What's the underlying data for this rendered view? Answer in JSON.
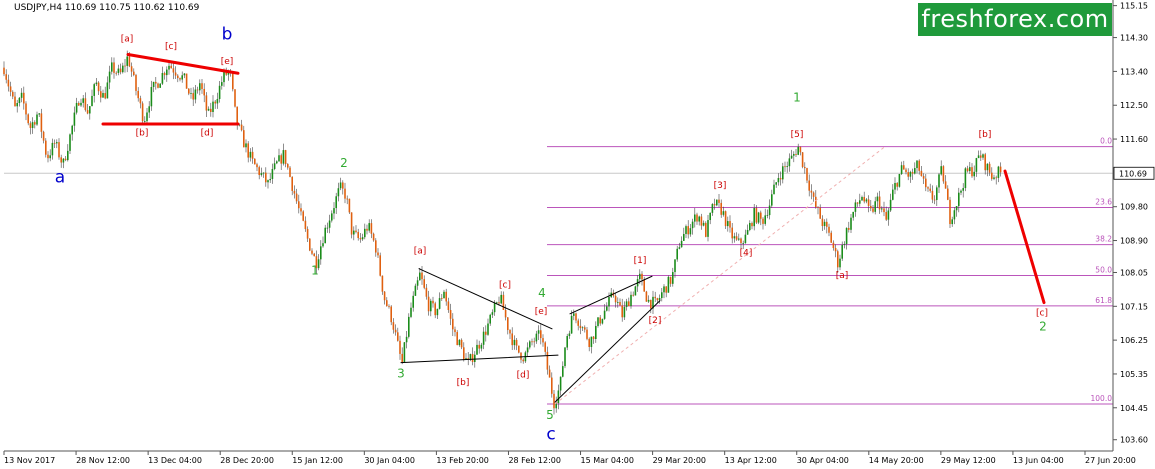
{
  "header": {
    "title": "USDJPY,H4  110.69 110.75 110.62 110.69",
    "brand": "freshforex.com"
  },
  "chart_data": {
    "type": "candlestick",
    "symbol": "USDJPY",
    "timeframe": "H4",
    "ohlc_readout": {
      "open": 110.69,
      "high": 110.75,
      "low": 110.62,
      "close": 110.69
    },
    "current_price": 110.69,
    "current_price_label": "110.69",
    "ylim": [
      103.3,
      115.3
    ],
    "y_ticks": [
      {
        "value": 115.15,
        "label": "115.15"
      },
      {
        "value": 114.3,
        "label": "114.30"
      },
      {
        "value": 113.4,
        "label": "113.40"
      },
      {
        "value": 112.5,
        "label": "112.50"
      },
      {
        "value": 111.6,
        "label": "111.60"
      },
      {
        "value": 109.8,
        "label": "109.80"
      },
      {
        "value": 108.9,
        "label": "108.90"
      },
      {
        "value": 108.05,
        "label": "108.05"
      },
      {
        "value": 107.15,
        "label": "107.15"
      },
      {
        "value": 106.25,
        "label": "106.25"
      },
      {
        "value": 105.35,
        "label": "105.35"
      },
      {
        "value": 104.45,
        "label": "104.45"
      },
      {
        "value": 103.6,
        "label": "103.60"
      }
    ],
    "x_ticks": [
      "13 Nov 2017",
      "28 Nov 12:00",
      "13 Dec 04:00",
      "28 Dec 20:00",
      "15 Jan 12:00",
      "30 Jan 04:00",
      "13 Feb 20:00",
      "28 Feb 12:00",
      "15 Mar 04:00",
      "29 Mar 20:00",
      "13 Apr 12:00",
      "30 Apr 04:00",
      "14 May 20:00",
      "29 May 12:00",
      "13 Jun 04:00",
      "27 Jun 20:00"
    ],
    "fibonacci": [
      {
        "level": "0.0",
        "price": 111.4
      },
      {
        "level": "23.6",
        "price": 109.78
      },
      {
        "level": "38.2",
        "price": 108.79
      },
      {
        "level": "50.0",
        "price": 107.97
      },
      {
        "level": "61.8",
        "price": 107.16
      },
      {
        "level": "100.0",
        "price": 104.55
      }
    ],
    "price_path": [
      [
        0,
        113.9
      ],
      [
        8,
        113.1
      ],
      [
        15,
        112.4
      ],
      [
        22,
        112.7
      ],
      [
        30,
        111.9
      ],
      [
        38,
        112.3
      ],
      [
        47,
        111.1
      ],
      [
        55,
        111.5
      ],
      [
        63,
        110.9
      ],
      [
        72,
        111.9
      ],
      [
        80,
        112.8
      ],
      [
        88,
        112.3
      ],
      [
        96,
        113.1
      ],
      [
        104,
        112.7
      ],
      [
        112,
        113.5
      ],
      [
        120,
        113.3
      ],
      [
        128,
        113.8
      ],
      [
        136,
        112.9
      ],
      [
        144,
        112.1
      ],
      [
        152,
        112.9
      ],
      [
        160,
        113.2
      ],
      [
        168,
        113.6
      ],
      [
        176,
        113.4
      ],
      [
        184,
        113.2
      ],
      [
        192,
        112.6
      ],
      [
        200,
        113.1
      ],
      [
        208,
        112.2
      ],
      [
        216,
        112.7
      ],
      [
        224,
        113.3
      ],
      [
        230,
        113.4
      ],
      [
        236,
        112.1
      ],
      [
        244,
        111.5
      ],
      [
        252,
        111.0
      ],
      [
        260,
        110.7
      ],
      [
        268,
        110.4
      ],
      [
        276,
        110.9
      ],
      [
        284,
        111.2
      ],
      [
        292,
        110.4
      ],
      [
        300,
        109.6
      ],
      [
        308,
        108.9
      ],
      [
        316,
        108.3
      ],
      [
        324,
        109.1
      ],
      [
        332,
        109.7
      ],
      [
        340,
        110.3
      ],
      [
        346,
        110.1
      ],
      [
        352,
        109.1
      ],
      [
        360,
        108.9
      ],
      [
        368,
        109.3
      ],
      [
        376,
        108.7
      ],
      [
        384,
        107.4
      ],
      [
        392,
        106.8
      ],
      [
        402,
        105.6
      ],
      [
        410,
        107.0
      ],
      [
        420,
        108.0
      ],
      [
        428,
        107.2
      ],
      [
        436,
        107.0
      ],
      [
        444,
        107.6
      ],
      [
        452,
        106.6
      ],
      [
        460,
        106.1
      ],
      [
        468,
        105.6
      ],
      [
        476,
        106.0
      ],
      [
        484,
        106.4
      ],
      [
        492,
        106.9
      ],
      [
        500,
        107.4
      ],
      [
        508,
        106.6
      ],
      [
        516,
        106.0
      ],
      [
        524,
        105.8
      ],
      [
        532,
        106.2
      ],
      [
        541,
        106.4
      ],
      [
        548,
        105.4
      ],
      [
        554,
        104.6
      ],
      [
        560,
        105.0
      ],
      [
        566,
        106.3
      ],
      [
        574,
        107.0
      ],
      [
        582,
        106.6
      ],
      [
        590,
        106.2
      ],
      [
        598,
        106.7
      ],
      [
        606,
        107.1
      ],
      [
        614,
        107.5
      ],
      [
        622,
        106.9
      ],
      [
        630,
        107.4
      ],
      [
        640,
        107.9
      ],
      [
        648,
        107.3
      ],
      [
        656,
        107.2
      ],
      [
        664,
        107.6
      ],
      [
        672,
        107.9
      ],
      [
        680,
        108.9
      ],
      [
        690,
        109.3
      ],
      [
        698,
        109.6
      ],
      [
        706,
        109.1
      ],
      [
        714,
        109.9
      ],
      [
        722,
        109.7
      ],
      [
        730,
        109.1
      ],
      [
        738,
        108.8
      ],
      [
        746,
        109.0
      ],
      [
        754,
        109.6
      ],
      [
        762,
        109.4
      ],
      [
        770,
        109.9
      ],
      [
        778,
        110.6
      ],
      [
        786,
        110.9
      ],
      [
        792,
        111.1
      ],
      [
        798,
        111.4
      ],
      [
        806,
        110.7
      ],
      [
        814,
        109.9
      ],
      [
        822,
        109.4
      ],
      [
        830,
        109.0
      ],
      [
        838,
        108.3
      ],
      [
        846,
        109.1
      ],
      [
        854,
        109.7
      ],
      [
        862,
        110.1
      ],
      [
        870,
        109.6
      ],
      [
        878,
        110.0
      ],
      [
        886,
        109.4
      ],
      [
        894,
        110.3
      ],
      [
        902,
        110.8
      ],
      [
        910,
        110.6
      ],
      [
        918,
        110.9
      ],
      [
        926,
        110.2
      ],
      [
        934,
        110.0
      ],
      [
        942,
        110.8
      ],
      [
        950,
        109.5
      ],
      [
        958,
        110.0
      ],
      [
        966,
        110.7
      ],
      [
        974,
        110.8
      ],
      [
        980,
        111.2
      ],
      [
        986,
        110.9
      ],
      [
        992,
        110.6
      ],
      [
        998,
        110.7
      ],
      [
        1002,
        110.69
      ]
    ],
    "wave_labels": [
      {
        "text": "a",
        "x": 60,
        "price": 110.45,
        "color": "#0000cc",
        "size": "large"
      },
      {
        "text": "b",
        "x": 227,
        "price": 114.25,
        "color": "#0000cc",
        "size": "large"
      },
      {
        "text": "c",
        "x": 551,
        "price": 103.6,
        "color": "#0000cc",
        "size": "large"
      },
      {
        "text": "[a]",
        "x": 127,
        "price": 114.2,
        "color": "#cc0000",
        "size": "small"
      },
      {
        "text": "[c]",
        "x": 171,
        "price": 114.0,
        "color": "#cc0000",
        "size": "small"
      },
      {
        "text": "[e]",
        "x": 227,
        "price": 113.6,
        "color": "#cc0000",
        "size": "small"
      },
      {
        "text": "[b]",
        "x": 142,
        "price": 111.7,
        "color": "#cc0000",
        "size": "small"
      },
      {
        "text": "[d]",
        "x": 207,
        "price": 111.7,
        "color": "#cc0000",
        "size": "small"
      },
      {
        "text": "2",
        "x": 344,
        "price": 110.85,
        "color": "#33aa33",
        "size": "medium"
      },
      {
        "text": "1",
        "x": 315,
        "price": 108.0,
        "color": "#33aa33",
        "size": "medium"
      },
      {
        "text": "3",
        "x": 401,
        "price": 105.25,
        "color": "#33aa33",
        "size": "medium"
      },
      {
        "text": "4",
        "x": 542,
        "price": 107.4,
        "color": "#33aa33",
        "size": "medium"
      },
      {
        "text": "5",
        "x": 550,
        "price": 104.15,
        "color": "#33aa33",
        "size": "medium"
      },
      {
        "text": "[a]",
        "x": 420,
        "price": 108.55,
        "color": "#cc0000",
        "size": "small"
      },
      {
        "text": "[c]",
        "x": 505,
        "price": 107.65,
        "color": "#cc0000",
        "size": "small"
      },
      {
        "text": "[e]",
        "x": 541,
        "price": 106.95,
        "color": "#cc0000",
        "size": "small"
      },
      {
        "text": "[b]",
        "x": 463,
        "price": 105.05,
        "color": "#cc0000",
        "size": "small"
      },
      {
        "text": "[d]",
        "x": 523,
        "price": 105.25,
        "color": "#cc0000",
        "size": "small"
      },
      {
        "text": "1",
        "x": 797,
        "price": 112.6,
        "color": "#33aa33",
        "size": "medium"
      },
      {
        "text": "[1]",
        "x": 640,
        "price": 108.3,
        "color": "#cc0000",
        "size": "small"
      },
      {
        "text": "[2]",
        "x": 655,
        "price": 106.7,
        "color": "#cc0000",
        "size": "small"
      },
      {
        "text": "[3]",
        "x": 720,
        "price": 110.3,
        "color": "#cc0000",
        "size": "small"
      },
      {
        "text": "[4]",
        "x": 746,
        "price": 108.5,
        "color": "#cc0000",
        "size": "small"
      },
      {
        "text": "[5]",
        "x": 797,
        "price": 111.65,
        "color": "#cc0000",
        "size": "small"
      },
      {
        "text": "[a]",
        "x": 842,
        "price": 107.9,
        "color": "#cc0000",
        "size": "small"
      },
      {
        "text": "[b]",
        "x": 985,
        "price": 111.65,
        "color": "#cc0000",
        "size": "small"
      },
      {
        "text": "[c]",
        "x": 1042,
        "price": 106.9,
        "color": "#cc0000",
        "size": "small"
      },
      {
        "text": "2",
        "x": 1043,
        "price": 106.5,
        "color": "#33aa33",
        "size": "medium"
      }
    ],
    "trendlines": [
      {
        "from": [
          128,
          113.85
        ],
        "to": [
          238,
          113.35
        ],
        "color": "#ee0000",
        "width": 3
      },
      {
        "from": [
          103,
          112.0
        ],
        "to": [
          238,
          112.0
        ],
        "color": "#ee0000",
        "width": 3
      },
      {
        "from": [
          419,
          108.15
        ],
        "to": [
          552,
          106.55
        ],
        "color": "#000000",
        "width": 1
      },
      {
        "from": [
          401,
          105.65
        ],
        "to": [
          558,
          105.85
        ],
        "color": "#000000",
        "width": 1
      },
      {
        "from": [
          570,
          106.95
        ],
        "to": [
          652,
          107.95
        ],
        "color": "#000000",
        "width": 1
      },
      {
        "from": [
          555,
          104.6
        ],
        "to": [
          660,
          107.3
        ],
        "color": "#000000",
        "width": 1
      },
      {
        "from": [
          1005,
          110.75
        ],
        "to": [
          1044,
          107.25
        ],
        "color": "#ee0000",
        "width": 3
      }
    ],
    "dashed_lines": [
      {
        "from": [
          555,
          104.55
        ],
        "to": [
          885,
          111.4
        ],
        "color": "#f0b0b0"
      }
    ],
    "colors": {
      "bull": "#1a8c1a",
      "bear": "#e06010",
      "wick": "#444444",
      "fib": "#bb55bb",
      "grid": "#e6e6e6",
      "axis": "#555555",
      "brand_bg": "#1f9a3b"
    },
    "grid": true
  }
}
